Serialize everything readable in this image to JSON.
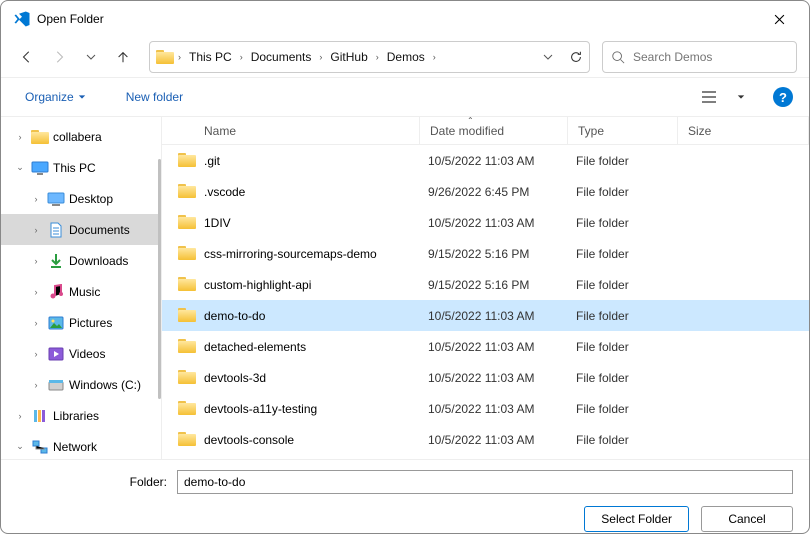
{
  "title": "Open Folder",
  "breadcrumbs": [
    "This PC",
    "Documents",
    "GitHub",
    "Demos"
  ],
  "search_placeholder": "Search Demos",
  "toolbar": {
    "organize": "Organize",
    "new_folder": "New folder"
  },
  "columns": {
    "name": "Name",
    "date": "Date modified",
    "type": "Type",
    "size": "Size"
  },
  "sidebar": [
    {
      "level": 1,
      "expand": "›",
      "icon": "folder",
      "label": "collabera"
    },
    {
      "level": 1,
      "expand": "⌄",
      "icon": "pc",
      "label": "This PC"
    },
    {
      "level": 2,
      "expand": "›",
      "icon": "desktop",
      "label": "Desktop"
    },
    {
      "level": 2,
      "expand": "›",
      "icon": "docs",
      "label": "Documents",
      "selected": true
    },
    {
      "level": 2,
      "expand": "›",
      "icon": "down",
      "label": "Downloads"
    },
    {
      "level": 2,
      "expand": "›",
      "icon": "music",
      "label": "Music"
    },
    {
      "level": 2,
      "expand": "›",
      "icon": "pics",
      "label": "Pictures"
    },
    {
      "level": 2,
      "expand": "›",
      "icon": "video",
      "label": "Videos"
    },
    {
      "level": 2,
      "expand": "›",
      "icon": "drive",
      "label": "Windows (C:)"
    },
    {
      "level": 1,
      "expand": "›",
      "icon": "lib",
      "label": "Libraries"
    },
    {
      "level": 1,
      "expand": "⌄",
      "icon": "net",
      "label": "Network"
    }
  ],
  "files": [
    {
      "name": ".git",
      "date": "10/5/2022 11:03 AM",
      "type": "File folder"
    },
    {
      "name": ".vscode",
      "date": "9/26/2022 6:45 PM",
      "type": "File folder"
    },
    {
      "name": "1DIV",
      "date": "10/5/2022 11:03 AM",
      "type": "File folder"
    },
    {
      "name": "css-mirroring-sourcemaps-demo",
      "date": "9/15/2022 5:16 PM",
      "type": "File folder"
    },
    {
      "name": "custom-highlight-api",
      "date": "9/15/2022 5:16 PM",
      "type": "File folder"
    },
    {
      "name": "demo-to-do",
      "date": "10/5/2022 11:03 AM",
      "type": "File folder",
      "selected": true
    },
    {
      "name": "detached-elements",
      "date": "10/5/2022 11:03 AM",
      "type": "File folder"
    },
    {
      "name": "devtools-3d",
      "date": "10/5/2022 11:03 AM",
      "type": "File folder"
    },
    {
      "name": "devtools-a11y-testing",
      "date": "10/5/2022 11:03 AM",
      "type": "File folder"
    },
    {
      "name": "devtools-console",
      "date": "10/5/2022 11:03 AM",
      "type": "File folder"
    }
  ],
  "folder_label": "Folder:",
  "folder_value": "demo-to-do",
  "buttons": {
    "select": "Select Folder",
    "cancel": "Cancel"
  }
}
